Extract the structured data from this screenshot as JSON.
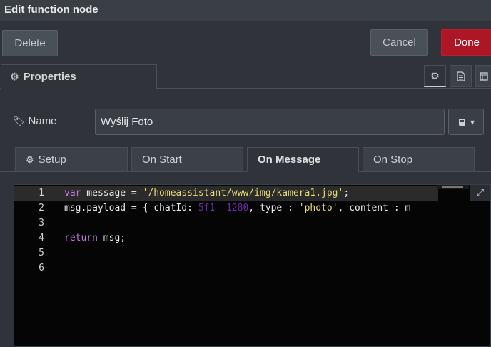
{
  "window": {
    "title": "Edit function node"
  },
  "actions": {
    "delete_label": "Delete",
    "cancel_label": "Cancel",
    "done_label": "Done"
  },
  "tabs": {
    "properties_label": "Properties",
    "settings_icon": "gear-icon",
    "description_icon": "document-icon",
    "appearance_icon": "layout-icon"
  },
  "name_field": {
    "label": "Name",
    "value": "Wyślij Foto",
    "icon": "tag-icon",
    "picker_icon": "book-icon"
  },
  "subtabs": [
    {
      "label": "Setup",
      "icon": "gear-icon"
    },
    {
      "label": "On Start"
    },
    {
      "label": "On Message",
      "active": true
    },
    {
      "label": "On Stop"
    }
  ],
  "editor": {
    "line_numbers": [
      "1",
      "2",
      "3",
      "4",
      "5",
      "6"
    ],
    "line1": {
      "kw": "var",
      "text": " message = ",
      "str": "'/homeassistant/www/img/kamera1.jpg'",
      "end": ";"
    },
    "line2": {
      "prefix": "msg.payload = { chatId: ",
      "redacted": "5f1  1280",
      "mid": ", type : ",
      "str": "'photo'",
      "suffix": ", content : m"
    },
    "line4": {
      "kw": "return",
      "text": " msg;"
    }
  },
  "colors": {
    "done_button": "#ad1625",
    "editor_bg": "#050505",
    "keyword": "#c678dd",
    "string": "#e6db74"
  }
}
